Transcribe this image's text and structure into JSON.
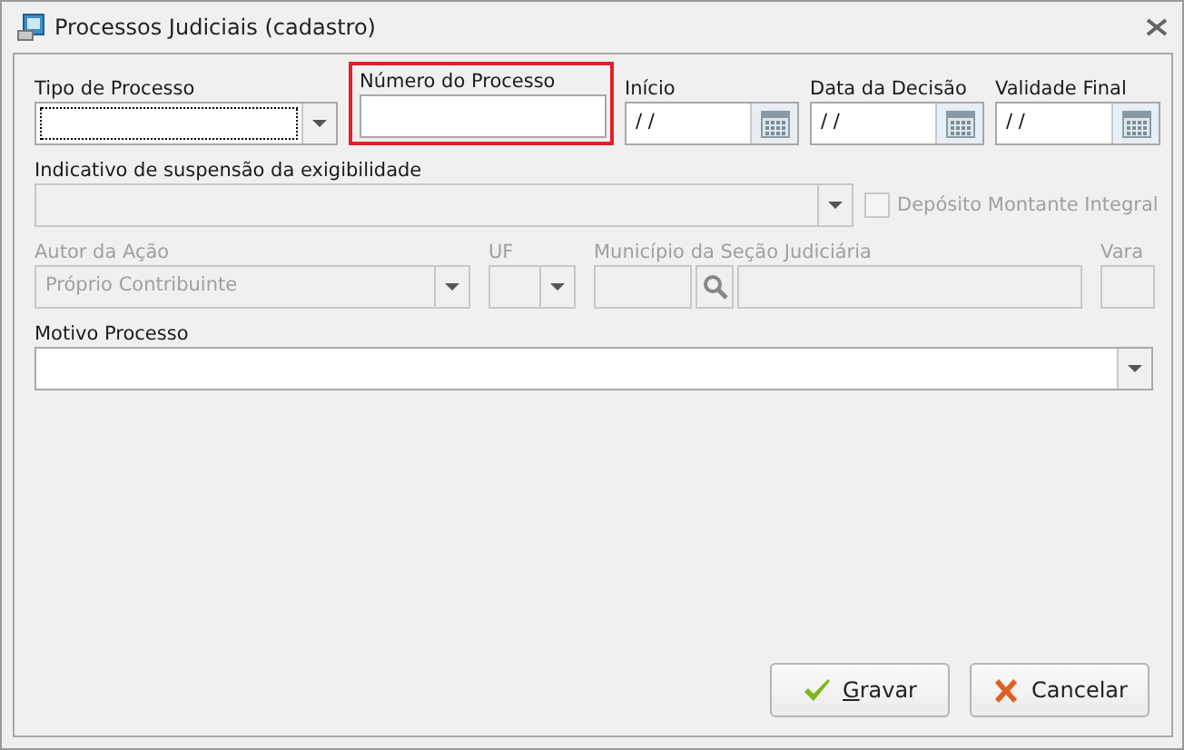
{
  "window": {
    "title": "Processos Judiciais (cadastro)"
  },
  "row1": [
    {
      "kind": "combo",
      "label": "Tipo de Processo",
      "focused": true,
      "highlighted": false,
      "disabled": false
    },
    {
      "kind": "text",
      "label": "Número do Processo",
      "focused": false,
      "highlighted": true,
      "disabled": false
    },
    {
      "kind": "date",
      "label": "Início",
      "value": "/ /",
      "highlighted": false,
      "disabled": false
    },
    {
      "kind": "date",
      "label": "Data da Decisão",
      "value": "/ /",
      "highlighted": false,
      "disabled": false
    },
    {
      "kind": "date",
      "label": "Validade Final",
      "value": "/ /",
      "highlighted": false,
      "disabled": false
    }
  ],
  "suspension": {
    "label": "Indicativo de suspensão da exigibilidade",
    "disabled": true,
    "checkbox": {
      "label": "Depósito Montante Integral",
      "checked": false,
      "disabled": true
    }
  },
  "row3": [
    {
      "kind": "combo",
      "label": "Autor da Ação",
      "value": "Próprio Contribuinte",
      "disabled": true
    },
    {
      "kind": "combo",
      "label": "UF",
      "disabled": true
    },
    {
      "kind": "lookup",
      "label": "Município da Seção Judiciária",
      "disabled": true
    },
    {
      "kind": "text",
      "label": "Vara",
      "disabled": true
    }
  ],
  "motivo": {
    "label": "Motivo Processo",
    "disabled": false
  },
  "buttons": [
    {
      "kind": "save",
      "label": "Gravar",
      "mnemonic": true
    },
    {
      "kind": "cancel",
      "label": "Cancelar",
      "mnemonic": false
    }
  ]
}
